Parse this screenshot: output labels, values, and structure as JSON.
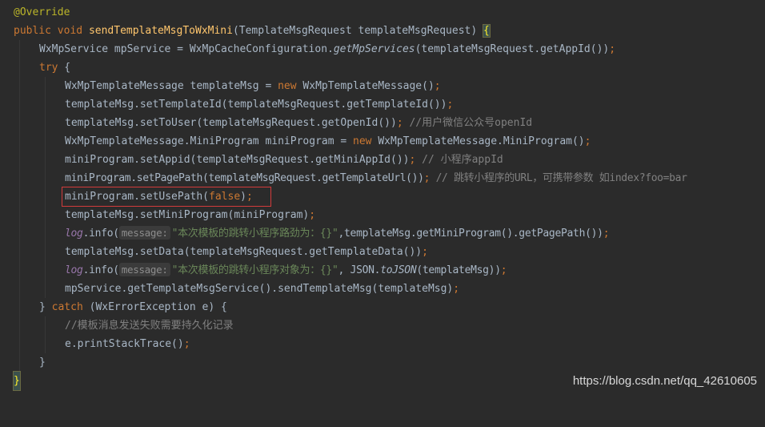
{
  "code": {
    "annotation": "@Override",
    "kw_public": "public",
    "kw_void": "void",
    "kw_new": "new",
    "kw_try": "try",
    "kw_catch": "catch",
    "kw_false": "false",
    "method_name": "sendTemplateMsgToWxMini",
    "params": "(TemplateMsgRequest templateMsgRequest) ",
    "open_brace": "{",
    "close_brace": "}",
    "l3_a": "WxMpService mpService = WxMpCacheConfiguration.",
    "l3_b": "getMpServices",
    "l3_c": "(templateMsgRequest.getAppId())",
    "semi": ";",
    "l4_b": " {",
    "l5_a": "WxMpTemplateMessage templateMsg = ",
    "l5_b": " WxMpTemplateMessage()",
    "l6": "templateMsg.setTemplateId(templateMsgRequest.getTemplateId())",
    "l7_a": "templateMsg.setToUser(templateMsgRequest.getOpenId())",
    "l7_cmt": " //用户微信公众号openId",
    "l8_a": "WxMpTemplateMessage.MiniProgram miniProgram = ",
    "l8_b": " WxMpTemplateMessage.MiniProgram()",
    "l9_a": "miniProgram.setAppid(templateMsgRequest.getMiniAppId())",
    "l9_cmt": " // 小程序appId",
    "l10_a": "miniProgram.setPagePath(templateMsgRequest.getTemplateUrl())",
    "l10_cmt": " // 跳转小程序的URL，可携带参数 如index?foo=bar",
    "l11_a": "miniProgram.setUsePath(",
    "l11_c": ")",
    "l12": "templateMsg.setMiniProgram(miniProgram)",
    "log": "log",
    "info": ".info(",
    "hint_message": "message:",
    "l13_str": "\"本次模板的跳转小程序路劲为：{}\"",
    "l13_rest": ",templateMsg.getMiniProgram().getPagePath())",
    "l14": "templateMsg.setData(templateMsgRequest.getTemplateData())",
    "l15_str": "\"本次模板的跳转小程序对象为：{}\"",
    "l15_b": ", JSON.",
    "l15_c": "toJSON",
    "l15_d": "(templateMsg))",
    "l16": "mpService.getTemplateMsgService().sendTemplateMsg(templateMsg)",
    "l17_a": "} ",
    "l17_c": " (WxErrorException e) {",
    "l18_cmt": "//模板消息发送失败需要持久化记录",
    "l19": "e.printStackTrace()"
  },
  "watermark": "https://blog.csdn.net/qq_42610605",
  "colors": {
    "background": "#2b2b2b",
    "default_text": "#a9b7c6",
    "keyword": "#cc7832",
    "annotation": "#bbb529",
    "method_decl": "#ffc66d",
    "string": "#6a8759",
    "comment": "#808080",
    "static_field": "#9876aa",
    "highlight_box": "#d23b3b"
  }
}
